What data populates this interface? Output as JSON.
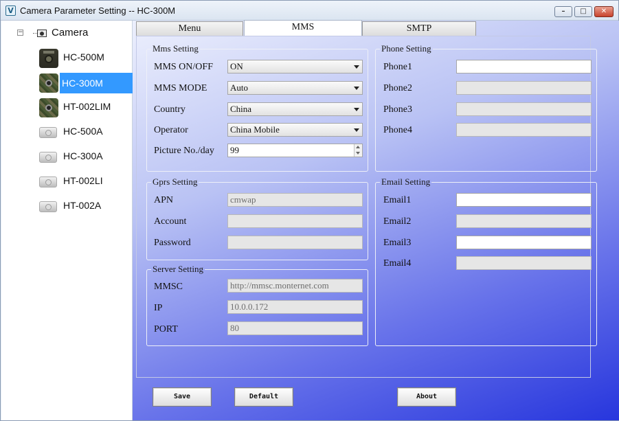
{
  "window": {
    "title": "Camera Parameter Setting -- HC-300M",
    "icon": "V",
    "min_glyph": "–",
    "max_glyph": "□",
    "close_glyph": "✕"
  },
  "tree": {
    "expander": "−",
    "root_label": "Camera",
    "items": [
      {
        "label": "HC-500M",
        "thumb": "camera-dark-icon"
      },
      {
        "label": "HC-300M",
        "thumb": "camera-camo-icon",
        "selected": true
      },
      {
        "label": "HT-002LIM",
        "thumb": "camera-camo-icon"
      },
      {
        "label": "HC-500A",
        "thumb": "camera-light-icon"
      },
      {
        "label": "HC-300A",
        "thumb": "camera-light-icon"
      },
      {
        "label": "HT-002LI",
        "thumb": "camera-light-icon"
      },
      {
        "label": "HT-002A",
        "thumb": "camera-light-icon"
      }
    ]
  },
  "tabs": [
    {
      "label": "Menu"
    },
    {
      "label": "MMS",
      "active": true
    },
    {
      "label": "SMTP"
    }
  ],
  "mms_setting": {
    "legend": "Mms Setting",
    "onoff_label": "MMS ON/OFF",
    "onoff_value": "ON",
    "mode_label": "MMS MODE",
    "mode_value": "Auto",
    "country_label": "Country",
    "country_value": "China",
    "operator_label": "Operator",
    "operator_value": "China Mobile",
    "picture_label": "Picture No./day",
    "picture_value": "99"
  },
  "gprs_setting": {
    "legend": "Gprs Setting",
    "apn_label": "APN",
    "apn_value": "cmwap",
    "account_label": "Account",
    "account_value": "",
    "password_label": "Password",
    "password_value": ""
  },
  "server_setting": {
    "legend": "Server Setting",
    "mmsc_label": "MMSC",
    "mmsc_value": "http://mmsc.monternet.com",
    "ip_label": "IP",
    "ip_value": "10.0.0.172",
    "port_label": "PORT",
    "port_value": "80"
  },
  "phone_setting": {
    "legend": "Phone Setting",
    "phones": [
      {
        "label": "Phone1",
        "value": ""
      },
      {
        "label": "Phone2",
        "value": ""
      },
      {
        "label": "Phone3",
        "value": ""
      },
      {
        "label": "Phone4",
        "value": ""
      }
    ]
  },
  "email_setting": {
    "legend": "Email Setting",
    "emails": [
      {
        "label": "Email1",
        "value": ""
      },
      {
        "label": "Email2",
        "value": ""
      },
      {
        "label": "Email3",
        "value": ""
      },
      {
        "label": "Email4",
        "value": ""
      }
    ]
  },
  "buttons": {
    "save": "Save",
    "default": "Default",
    "about": "About"
  },
  "colors": {
    "selection": "#3399ff",
    "panel_gradient_end": "#2736dd"
  }
}
